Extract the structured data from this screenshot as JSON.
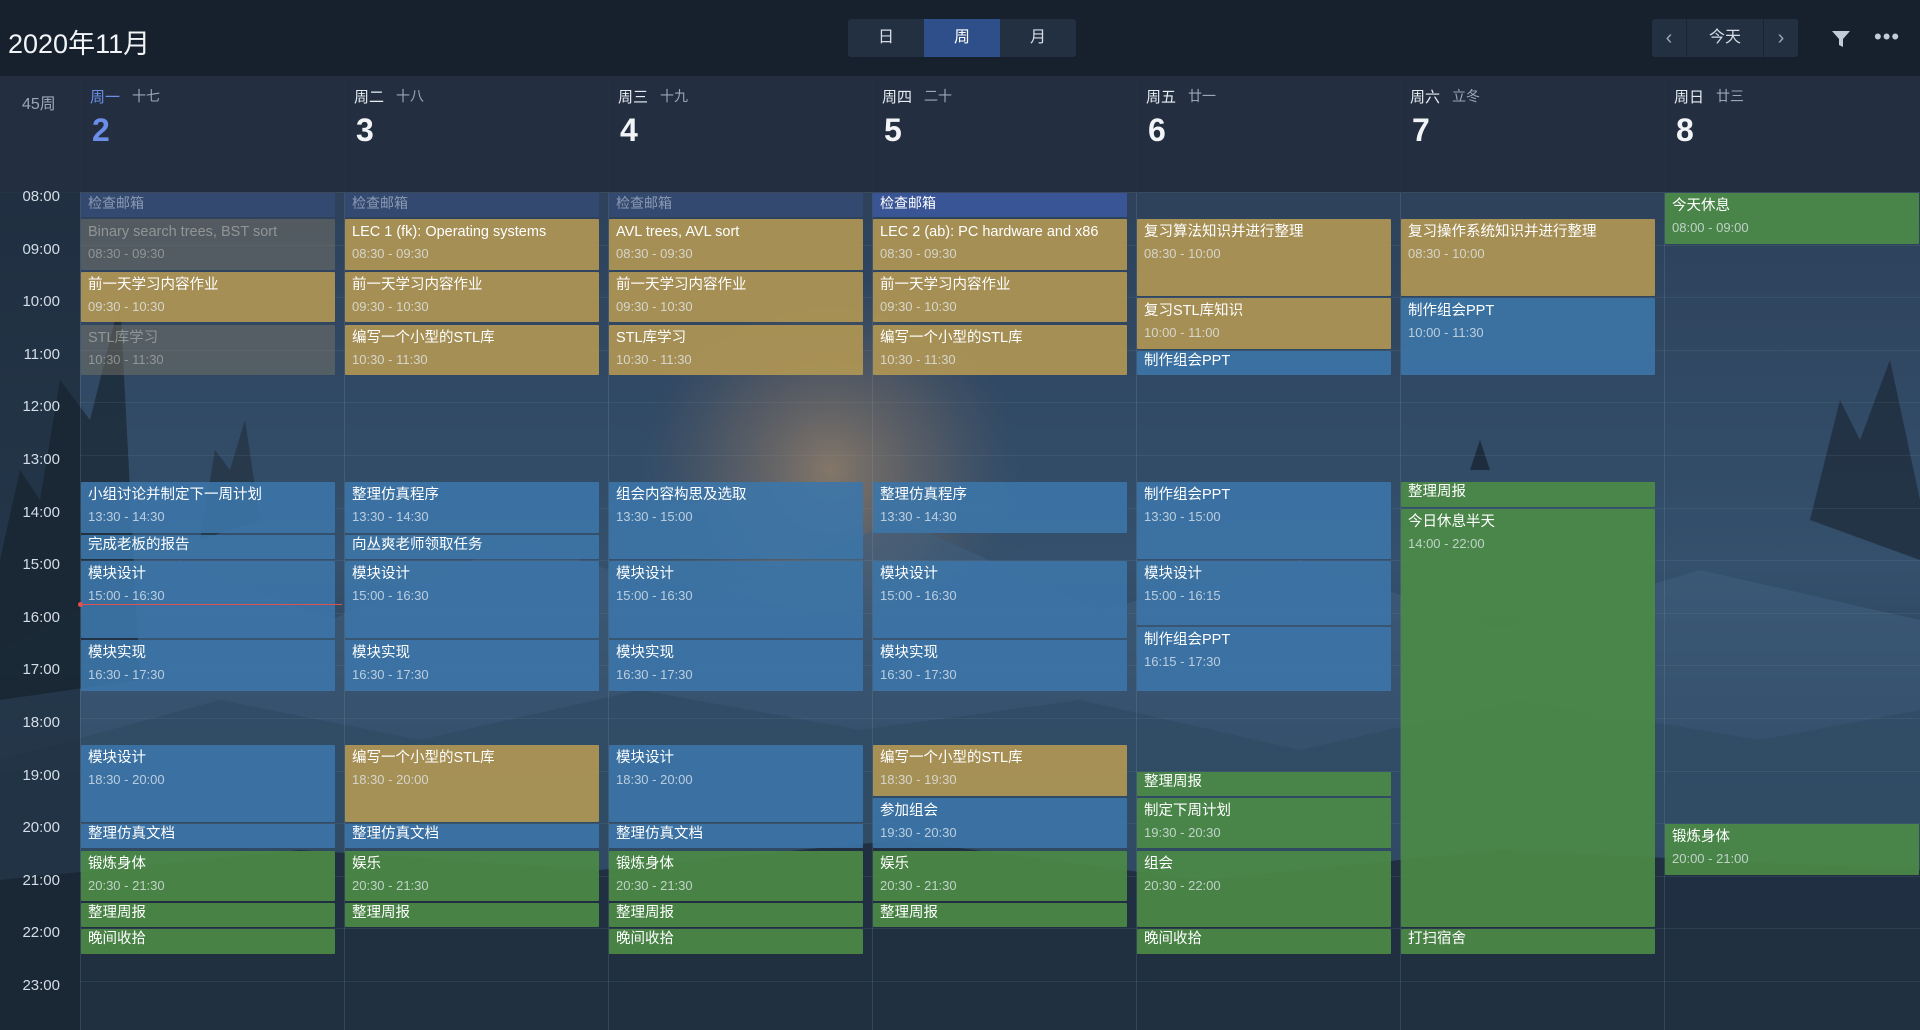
{
  "header": {
    "month_title": "2020年11月",
    "week_label": "45周"
  },
  "view_switch": {
    "day": "日",
    "week": "周",
    "month": "月",
    "active": "周"
  },
  "nav": {
    "prev": "‹",
    "today": "今天",
    "next": "›"
  },
  "colors": {
    "gold": "#b09654",
    "blue": "#3c76a8",
    "green": "#4c8c46",
    "today_accent": "#6c8ee8",
    "now_line": "#e0504c"
  },
  "days": [
    {
      "name": "周一",
      "lunar": "十七",
      "num": "2",
      "today": true
    },
    {
      "name": "周二",
      "lunar": "十八",
      "num": "3"
    },
    {
      "name": "周三",
      "lunar": "十九",
      "num": "4"
    },
    {
      "name": "周四",
      "lunar": "二十",
      "num": "5"
    },
    {
      "name": "周五",
      "lunar": "廿一",
      "num": "6"
    },
    {
      "name": "周六",
      "lunar": "立冬",
      "num": "7"
    },
    {
      "name": "周日",
      "lunar": "廿三",
      "num": "8"
    }
  ],
  "hours": [
    "08:00",
    "09:00",
    "10:00",
    "11:00",
    "12:00",
    "13:00",
    "14:00",
    "15:00",
    "16:00",
    "17:00",
    "18:00",
    "19:00",
    "20:00",
    "21:00",
    "22:00",
    "23:00"
  ],
  "events": [
    {
      "day": 0,
      "start": 8.0,
      "end": 8.5,
      "title": "检查邮箱",
      "kind": "mail"
    },
    {
      "day": 0,
      "start": 8.5,
      "end": 9.5,
      "title": "Binary search trees, BST sort",
      "time": "08:30 - 09:30",
      "kind": "grey"
    },
    {
      "day": 0,
      "start": 9.5,
      "end": 10.5,
      "title": "前一天学习内容作业",
      "time": "09:30 - 10:30",
      "kind": "gold"
    },
    {
      "day": 0,
      "start": 10.5,
      "end": 11.5,
      "title": "STL库学习",
      "time": "10:30 - 11:30",
      "kind": "grey"
    },
    {
      "day": 0,
      "start": 13.5,
      "end": 14.5,
      "title": "小组讨论并制定下一周计划",
      "time": "13:30 - 14:30",
      "kind": "blue"
    },
    {
      "day": 0,
      "start": 14.5,
      "end": 15.0,
      "title": "完成老板的报告",
      "kind": "blue"
    },
    {
      "day": 0,
      "start": 15.0,
      "end": 16.5,
      "title": "模块设计",
      "time": "15:00 - 16:30",
      "kind": "blue"
    },
    {
      "day": 0,
      "start": 16.5,
      "end": 17.5,
      "title": "模块实现",
      "time": "16:30 - 17:30",
      "kind": "blue"
    },
    {
      "day": 0,
      "start": 18.5,
      "end": 20.0,
      "title": "模块设计",
      "time": "18:30 - 20:00",
      "kind": "blue"
    },
    {
      "day": 0,
      "start": 20.0,
      "end": 20.5,
      "title": "整理仿真文档",
      "kind": "blue"
    },
    {
      "day": 0,
      "start": 20.5,
      "end": 21.5,
      "title": "锻炼身体",
      "time": "20:30 - 21:30",
      "kind": "green"
    },
    {
      "day": 0,
      "start": 21.5,
      "end": 22.0,
      "title": "整理周报",
      "kind": "green"
    },
    {
      "day": 0,
      "start": 22.0,
      "end": 22.5,
      "title": "晚间收拾",
      "kind": "green"
    },
    {
      "day": 1,
      "start": 8.0,
      "end": 8.5,
      "title": "检查邮箱",
      "kind": "mail"
    },
    {
      "day": 1,
      "start": 8.5,
      "end": 9.5,
      "title": "LEC 1 (fk): Operating systems",
      "time": "08:30 - 09:30",
      "kind": "gold"
    },
    {
      "day": 1,
      "start": 9.5,
      "end": 10.5,
      "title": "前一天学习内容作业",
      "time": "09:30 - 10:30",
      "kind": "gold"
    },
    {
      "day": 1,
      "start": 10.5,
      "end": 11.5,
      "title": "编写一个小型的STL库",
      "time": "10:30 - 11:30",
      "kind": "gold"
    },
    {
      "day": 1,
      "start": 13.5,
      "end": 14.5,
      "title": "整理仿真程序",
      "time": "13:30 - 14:30",
      "kind": "blue"
    },
    {
      "day": 1,
      "start": 14.5,
      "end": 15.0,
      "title": "向丛爽老师领取任务",
      "kind": "blue"
    },
    {
      "day": 1,
      "start": 15.0,
      "end": 16.5,
      "title": "模块设计",
      "time": "15:00 - 16:30",
      "kind": "blue"
    },
    {
      "day": 1,
      "start": 16.5,
      "end": 17.5,
      "title": "模块实现",
      "time": "16:30 - 17:30",
      "kind": "blue"
    },
    {
      "day": 1,
      "start": 18.5,
      "end": 20.0,
      "title": "编写一个小型的STL库",
      "time": "18:30 - 20:00",
      "kind": "gold"
    },
    {
      "day": 1,
      "start": 20.0,
      "end": 20.5,
      "title": "整理仿真文档",
      "kind": "blue"
    },
    {
      "day": 1,
      "start": 20.5,
      "end": 21.5,
      "title": "娱乐",
      "time": "20:30 - 21:30",
      "kind": "green"
    },
    {
      "day": 1,
      "start": 21.5,
      "end": 22.0,
      "title": "整理周报",
      "kind": "green"
    },
    {
      "day": 2,
      "start": 8.0,
      "end": 8.5,
      "title": "检查邮箱",
      "kind": "mail"
    },
    {
      "day": 2,
      "start": 8.5,
      "end": 9.5,
      "title": "AVL trees, AVL sort",
      "time": "08:30 - 09:30",
      "kind": "gold"
    },
    {
      "day": 2,
      "start": 9.5,
      "end": 10.5,
      "title": "前一天学习内容作业",
      "time": "09:30 - 10:30",
      "kind": "gold"
    },
    {
      "day": 2,
      "start": 10.5,
      "end": 11.5,
      "title": "STL库学习",
      "time": "10:30 - 11:30",
      "kind": "gold"
    },
    {
      "day": 2,
      "start": 13.5,
      "end": 15.0,
      "title": "组会内容构思及选取",
      "time": "13:30 - 15:00",
      "kind": "blue"
    },
    {
      "day": 2,
      "start": 15.0,
      "end": 16.5,
      "title": "模块设计",
      "time": "15:00 - 16:30",
      "kind": "blue"
    },
    {
      "day": 2,
      "start": 16.5,
      "end": 17.5,
      "title": "模块实现",
      "time": "16:30 - 17:30",
      "kind": "blue"
    },
    {
      "day": 2,
      "start": 18.5,
      "end": 20.0,
      "title": "模块设计",
      "time": "18:30 - 20:00",
      "kind": "blue"
    },
    {
      "day": 2,
      "start": 20.0,
      "end": 20.5,
      "title": "整理仿真文档",
      "kind": "blue"
    },
    {
      "day": 2,
      "start": 20.5,
      "end": 21.5,
      "title": "锻炼身体",
      "time": "20:30 - 21:30",
      "kind": "green"
    },
    {
      "day": 2,
      "start": 21.5,
      "end": 22.0,
      "title": "整理周报",
      "kind": "green"
    },
    {
      "day": 2,
      "start": 22.0,
      "end": 22.5,
      "title": "晚间收拾",
      "kind": "green"
    },
    {
      "day": 3,
      "start": 8.0,
      "end": 8.5,
      "title": "检查邮箱",
      "kind": "mail-active"
    },
    {
      "day": 3,
      "start": 8.5,
      "end": 9.5,
      "title": "LEC 2 (ab): PC hardware and x86",
      "time": "08:30 - 09:30",
      "kind": "gold"
    },
    {
      "day": 3,
      "start": 9.5,
      "end": 10.5,
      "title": "前一天学习内容作业",
      "time": "09:30 - 10:30",
      "kind": "gold"
    },
    {
      "day": 3,
      "start": 10.5,
      "end": 11.5,
      "title": "编写一个小型的STL库",
      "time": "10:30 - 11:30",
      "kind": "gold"
    },
    {
      "day": 3,
      "start": 13.5,
      "end": 14.5,
      "title": "整理仿真程序",
      "time": "13:30 - 14:30",
      "kind": "blue"
    },
    {
      "day": 3,
      "start": 15.0,
      "end": 16.5,
      "title": "模块设计",
      "time": "15:00 - 16:30",
      "kind": "blue"
    },
    {
      "day": 3,
      "start": 16.5,
      "end": 17.5,
      "title": "模块实现",
      "time": "16:30 - 17:30",
      "kind": "blue"
    },
    {
      "day": 3,
      "start": 18.5,
      "end": 19.5,
      "title": "编写一个小型的STL库",
      "time": "18:30 - 19:30",
      "kind": "gold"
    },
    {
      "day": 3,
      "start": 19.5,
      "end": 20.5,
      "title": "参加组会",
      "time": "19:30 - 20:30",
      "kind": "blue"
    },
    {
      "day": 3,
      "start": 20.5,
      "end": 21.5,
      "title": "娱乐",
      "time": "20:30 - 21:30",
      "kind": "green"
    },
    {
      "day": 3,
      "start": 21.5,
      "end": 22.0,
      "title": "整理周报",
      "kind": "green"
    },
    {
      "day": 4,
      "start": 8.5,
      "end": 10.0,
      "title": "复习算法知识并进行整理",
      "time": "08:30 - 10:00",
      "kind": "gold"
    },
    {
      "day": 4,
      "start": 10.0,
      "end": 11.0,
      "title": "复习STL库知识",
      "time": "10:00 - 11:00",
      "kind": "gold"
    },
    {
      "day": 4,
      "start": 11.0,
      "end": 11.5,
      "title": "制作组会PPT",
      "kind": "blue"
    },
    {
      "day": 4,
      "start": 13.5,
      "end": 15.0,
      "title": "制作组会PPT",
      "time": "13:30 - 15:00",
      "kind": "blue"
    },
    {
      "day": 4,
      "start": 15.0,
      "end": 16.25,
      "title": "模块设计",
      "time": "15:00 - 16:15",
      "kind": "blue"
    },
    {
      "day": 4,
      "start": 16.25,
      "end": 17.5,
      "title": "制作组会PPT",
      "time": "16:15 - 17:30",
      "kind": "blue"
    },
    {
      "day": 4,
      "start": 19.0,
      "end": 19.5,
      "title": "整理周报",
      "kind": "green"
    },
    {
      "day": 4,
      "start": 19.5,
      "end": 20.5,
      "title": "制定下周计划",
      "time": "19:30 - 20:30",
      "kind": "green"
    },
    {
      "day": 4,
      "start": 20.5,
      "end": 22.0,
      "title": "组会",
      "time": "20:30 - 22:00",
      "kind": "green"
    },
    {
      "day": 4,
      "start": 22.0,
      "end": 22.5,
      "title": "晚间收拾",
      "kind": "green"
    },
    {
      "day": 5,
      "start": 8.5,
      "end": 10.0,
      "title": "复习操作系统知识并进行整理",
      "time": "08:30 - 10:00",
      "kind": "gold"
    },
    {
      "day": 5,
      "start": 10.0,
      "end": 11.5,
      "title": "制作组会PPT",
      "time": "10:00 - 11:30",
      "kind": "blue"
    },
    {
      "day": 5,
      "start": 13.5,
      "end": 14.0,
      "title": "整理周报",
      "kind": "green"
    },
    {
      "day": 5,
      "start": 14.0,
      "end": 22.0,
      "title": "今日休息半天",
      "time": "14:00 - 22:00",
      "kind": "green"
    },
    {
      "day": 5,
      "start": 22.0,
      "end": 22.5,
      "title": "打扫宿舍",
      "kind": "green"
    },
    {
      "day": 6,
      "start": 8.0,
      "end": 9.0,
      "title": "今天休息",
      "time": "08:00 - 09:00",
      "kind": "green"
    },
    {
      "day": 6,
      "start": 20.0,
      "end": 21.0,
      "title": "锻炼身体",
      "time": "20:00 - 21:00",
      "kind": "green"
    }
  ]
}
